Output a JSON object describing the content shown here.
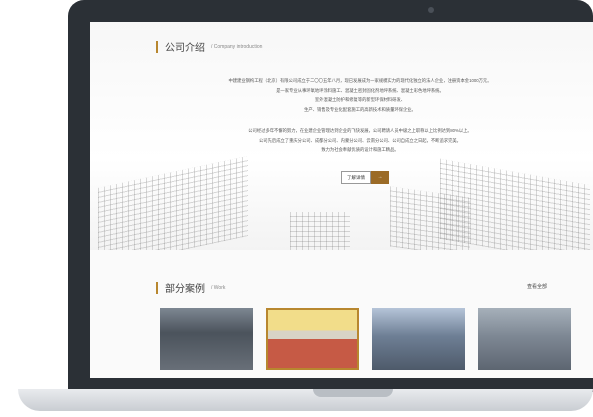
{
  "intro": {
    "title": "公司介绍",
    "subtitle": "/  Company introduction",
    "paragraph1_line1": "中建建业钢构工程（北京）有限公司成立于二〇〇五年八月，现已发展成为一家规模实力的现代化独立的法人企业，注册资本金1000万元。",
    "paragraph1_line2": "是一家专业从事环氧地坪涂料施工、混凝土密封固化剂地坪系统、混凝土彩色地坪系统。",
    "paragraph1_line3": "室外混凝土防护和修复等的新型环保材料研发、",
    "paragraph1_line4": "生产、销售及专业化配套施工的高新技术和质量环保企业。",
    "paragraph2_line1": "公司经过多年不懈的努力，在业建企业管理达到企业的飞快发展，公司聘请人员中级之上职称以上比例达到80%以上。",
    "paragraph2_line2": "公司先后成立了重庆分公司、成都分公司、内蒙分公司、云南分公司、公司自成立之日起，不断追求完美。",
    "paragraph2_line3": "致力为社会奉献优质的设计和施工精品。",
    "more_button": "了解详情",
    "arrow_button": "→"
  },
  "cases": {
    "title": "部分案例",
    "subtitle": "/  Work",
    "view_all": "查看全部"
  }
}
